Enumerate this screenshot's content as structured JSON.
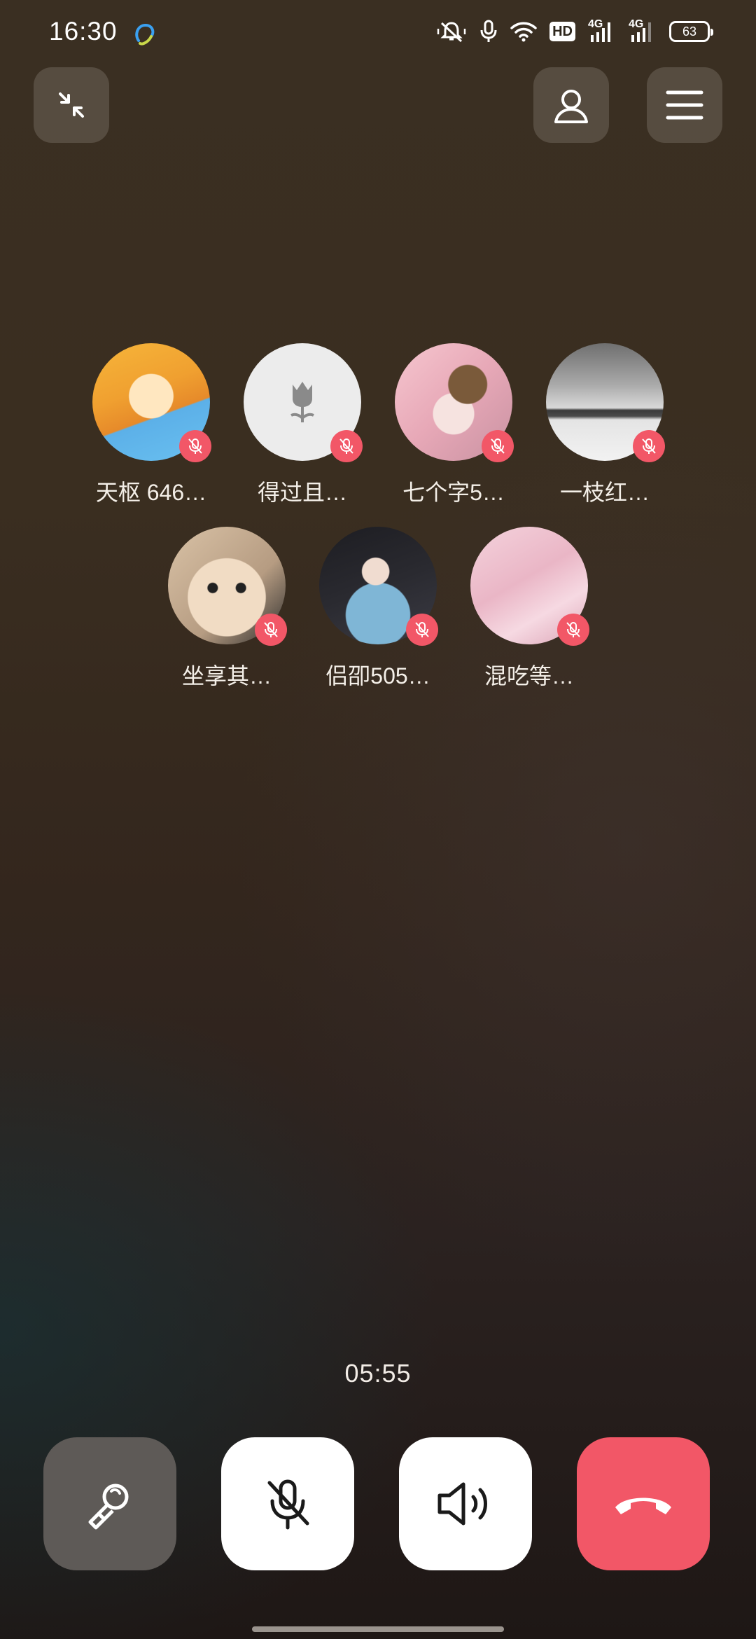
{
  "status_bar": {
    "time": "16:30",
    "hd_label": "HD",
    "net1": "4G",
    "net2": "4G",
    "battery": "63",
    "icons": [
      "assistant-icon",
      "mute-bell-icon",
      "microphone-icon",
      "wifi-icon",
      "hd-icon",
      "signal-icon",
      "signal-icon",
      "battery-icon"
    ]
  },
  "toolbar": {
    "minimize_icon": "minimize-icon",
    "contacts_icon": "person-icon",
    "menu_icon": "menu-icon"
  },
  "participants": [
    {
      "name": "天枢 646…",
      "muted": true
    },
    {
      "name": "得过且…",
      "muted": true
    },
    {
      "name": "七个字5…",
      "muted": true
    },
    {
      "name": "一枝红…",
      "muted": true
    },
    {
      "name": "坐享其…",
      "muted": true
    },
    {
      "name": "侣卲505…",
      "muted": true
    },
    {
      "name": "混吃等…",
      "muted": true
    }
  ],
  "call": {
    "duration": "05:55"
  },
  "controls": {
    "effect": "magic-wand-icon",
    "mic": "mic-off-icon",
    "speaker": "speaker-icon",
    "hangup": "hang-up-icon"
  },
  "colors": {
    "hangup": "#f25767",
    "mute_badge": "#f25767",
    "button_light": "#ffffff",
    "button_dark": "#5e5a57"
  }
}
